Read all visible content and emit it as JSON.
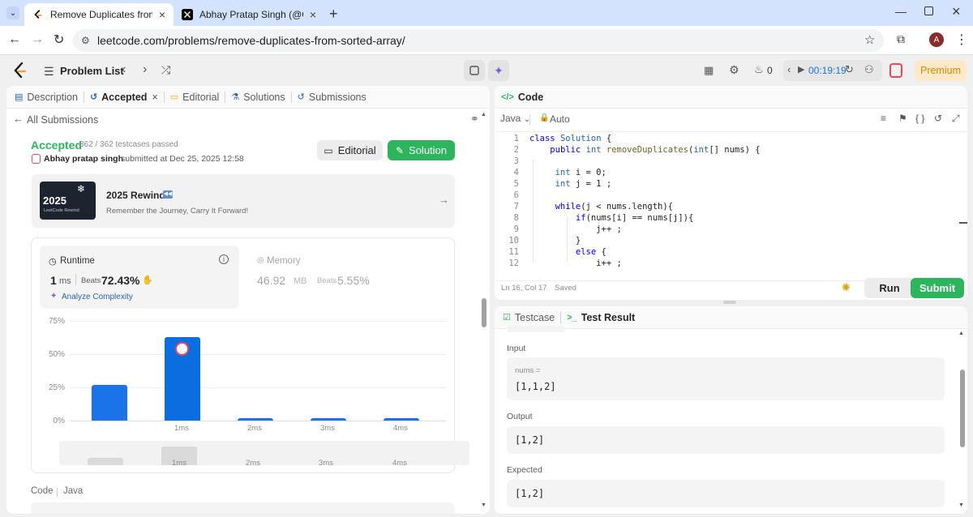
{
  "browser": {
    "tabs": [
      {
        "title": "Remove Duplicates from Sorted",
        "active": true
      },
      {
        "title": "Abhay Pratap Singh (@Codewit",
        "active": false
      }
    ],
    "url": "leetcode.com/problems/remove-duplicates-from-sorted-array/",
    "profile_initial": "A"
  },
  "nav": {
    "problem_list": "Problem List",
    "streak_count": "0",
    "timer": "00:19:19",
    "premium": "Premium"
  },
  "left": {
    "tabs": {
      "description": "Description",
      "accepted": "Accepted",
      "editorial": "Editorial",
      "solutions": "Solutions",
      "submissions": "Submissions"
    },
    "all_submissions": "All Submissions",
    "status": "Accepted",
    "testcases": "362 / 362 testcases passed",
    "user": "Abhay pratap singh",
    "submitted_at": "submitted at Dec 25, 2025 12:58",
    "editorial_btn": "Editorial",
    "solution_btn": "Solution",
    "rewind": {
      "year": "2025",
      "subtitle": "LeetCode Rewind",
      "title": "2025 Rewind",
      "desc": "Remember the Journey, Carry It Forward!"
    },
    "runtime": {
      "label": "Runtime",
      "value": "1",
      "unit": "ms",
      "beats_label": "Beats",
      "beats": "72.43%",
      "analyze": "Analyze Complexity"
    },
    "memory": {
      "label": "Memory",
      "value": "46.92",
      "unit": "MB",
      "beats_label": "Beats",
      "beats": "5.55%"
    },
    "chart_y_labels": [
      "75%",
      "50%",
      "25%",
      "0%"
    ],
    "chart_x_labels": [
      "1ms",
      "2ms",
      "3ms",
      "4ms"
    ],
    "code_label": "Code",
    "lang_label": "Java"
  },
  "chart_data": {
    "type": "bar",
    "categories": [
      "",
      "1ms",
      "2ms",
      "3ms",
      "4ms"
    ],
    "values": [
      27,
      63,
      1.5,
      1.5,
      1.5
    ],
    "ylim": [
      0,
      75
    ],
    "xlabel": "",
    "ylabel": "",
    "grid": true,
    "highlight_category": "1ms"
  },
  "editor": {
    "header": "Code",
    "language": "Java",
    "mode": "Auto",
    "status": "Ln 16, Col 17",
    "saved": "Saved",
    "run": "Run",
    "submit": "Submit",
    "lines": [
      {
        "n": "1",
        "text": "class Solution {"
      },
      {
        "n": "2",
        "text": "    public int removeDuplicates(int[] nums) {"
      },
      {
        "n": "3",
        "text": ""
      },
      {
        "n": "4",
        "text": "     int i = 0;"
      },
      {
        "n": "5",
        "text": "     int j = 1 ;"
      },
      {
        "n": "6",
        "text": ""
      },
      {
        "n": "7",
        "text": "     while(j < nums.length){"
      },
      {
        "n": "8",
        "text": "         if(nums[i] == nums[j]){"
      },
      {
        "n": "9",
        "text": "             j++ ;"
      },
      {
        "n": "10",
        "text": "         }"
      },
      {
        "n": "11",
        "text": "         else {"
      },
      {
        "n": "12",
        "text": "             i++ ;"
      }
    ]
  },
  "result": {
    "tab_testcase": "Testcase",
    "tab_result": "Test Result",
    "input_label": "Input",
    "input_var": "nums =",
    "input_value": "[1,1,2]",
    "output_label": "Output",
    "output_value": "[1,2]",
    "expected_label": "Expected",
    "expected_value": "[1,2]"
  }
}
